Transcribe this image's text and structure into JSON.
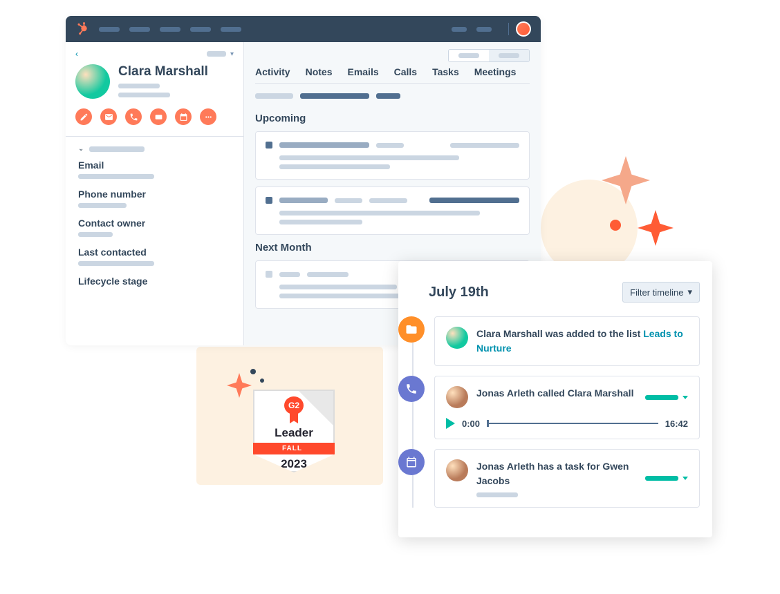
{
  "contact": {
    "name": "Clara Marshall",
    "action_icons": [
      "edit-icon",
      "email-icon",
      "phone-icon",
      "card-icon",
      "calendar-icon",
      "more-icon"
    ],
    "fields": [
      {
        "label": "Email"
      },
      {
        "label": "Phone number"
      },
      {
        "label": "Contact owner"
      },
      {
        "label": "Last contacted"
      },
      {
        "label": "Lifecycle stage"
      }
    ]
  },
  "tabs": [
    "Activity",
    "Notes",
    "Emails",
    "Calls",
    "Tasks",
    "Meetings"
  ],
  "sections": {
    "upcoming": "Upcoming",
    "next_month": "Next Month"
  },
  "timeline": {
    "date": "July 19th",
    "filter_label": "Filter timeline",
    "items": [
      {
        "icon": "folder-icon",
        "icon_color": "ti-orange",
        "avatar": "av1",
        "text_pre": "Clara Marshall was added to the list ",
        "link": "Leads to Nurture"
      },
      {
        "icon": "phone-icon",
        "icon_color": "ti-purple",
        "avatar": "av2",
        "text": "Jonas Arleth called Clara Marshall",
        "audio": {
          "current": "0:00",
          "total": "16:42"
        }
      },
      {
        "icon": "calendar-icon",
        "icon_color": "ti-purple",
        "avatar": "av2",
        "text": "Jonas Arleth has a task for Gwen Jacobs"
      }
    ]
  },
  "badge": {
    "logo": "G2",
    "title": "Leader",
    "season": "FALL",
    "year": "2023"
  }
}
